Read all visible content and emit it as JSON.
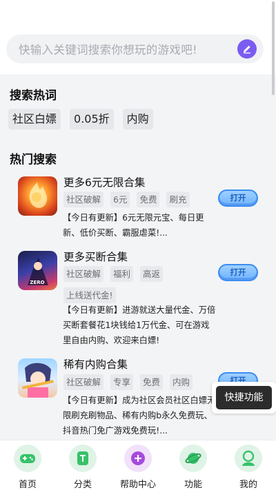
{
  "search": {
    "placeholder": "快输入关键词搜索你想玩的游戏吧!"
  },
  "hot_words": {
    "title": "搜索热词",
    "items": [
      "社区白嫖",
      "0.05折",
      "内购"
    ]
  },
  "hot_search": {
    "title": "热门搜索",
    "games": [
      {
        "name": "更多6元无限合集",
        "tags": [
          "社区破解",
          "6元",
          "免费",
          "刷充"
        ],
        "desc": "【今日有更新】6元无限元宝、每日更新、低价买断、霸服虐菜!...",
        "button": "打开",
        "icon": "fire-warrior-game-icon"
      },
      {
        "name": "更多买断合集",
        "tags": [
          "社区破解",
          "福利",
          "高返",
          "上线送代金!"
        ],
        "desc": "【今日有更新】进游就送大量代金、万倍买断套餐花1块钱给1万代金、可在游戏里自由内购、欢迎来白嫖!",
        "button": "打开",
        "icon": "zero-hero-game-icon"
      },
      {
        "name": "稀有内购合集",
        "tags": [
          "社区破解",
          "专享",
          "免费",
          "内购"
        ],
        "desc": "【今日有更新】成为社区会员社区白嫖无限刷充刷物品、稀有内购b永久免费玩、抖音热门免广游戏免费玩!...",
        "button": "打开",
        "icon": "anime-girl-game-icon"
      }
    ]
  },
  "quick_function": "快捷功能",
  "tabbar": {
    "items": [
      {
        "label": "首页",
        "icon": "gamepad-icon",
        "color": "#37c26a"
      },
      {
        "label": "分类",
        "icon": "category-icon",
        "color": "#37c26a"
      },
      {
        "label": "帮助中心",
        "icon": "plus-icon",
        "color": "#a54bdc"
      },
      {
        "label": "功能",
        "icon": "planet-icon",
        "color": "#37c26a"
      },
      {
        "label": "我的",
        "icon": "user-icon",
        "color": "#37c26a"
      }
    ]
  },
  "colors": {
    "accent": "#7b5cf0",
    "button": "#6fb3ff",
    "tab_green": "#37c26a"
  }
}
